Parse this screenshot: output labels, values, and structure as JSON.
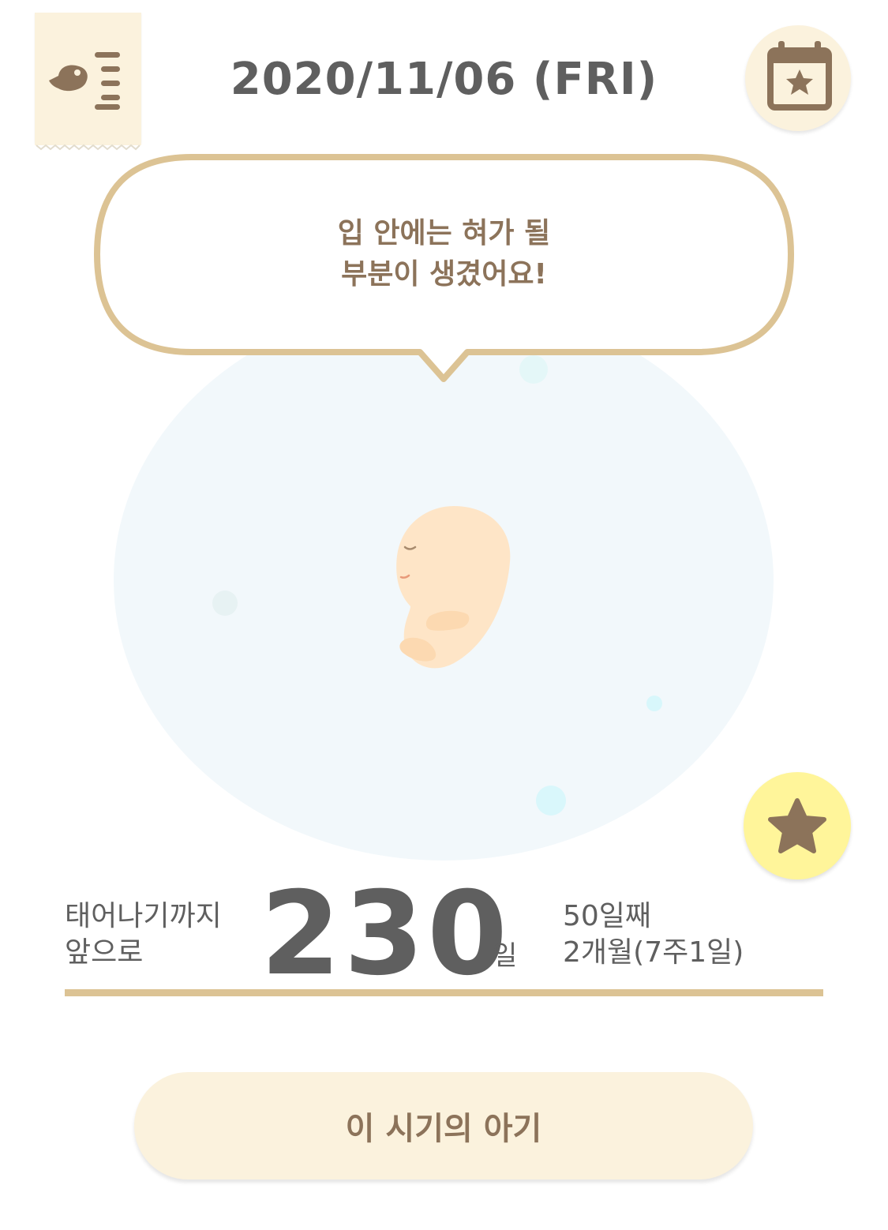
{
  "header": {
    "date": "2020/11/06 (FRI)",
    "menu_icon": "bird-list-icon",
    "calendar_icon": "calendar-star-icon"
  },
  "bubble": {
    "line1": "입 안에는 혀가 될",
    "line2": "부분이 생겼어요!"
  },
  "countdown": {
    "label_line1": "태어나기까지",
    "label_line2": "앞으로",
    "days": "230",
    "unit": "일"
  },
  "progress": {
    "day_count": "50일째",
    "month_week": "2개월(7주1일)"
  },
  "button": {
    "label": "이 시기의 아기"
  },
  "colors": {
    "accent_brown": "#8c735a",
    "bubble_border": "#dcc394",
    "cream": "#fbf2dd",
    "star_yellow": "#fff59a",
    "text_gray": "#5f5f5f"
  }
}
